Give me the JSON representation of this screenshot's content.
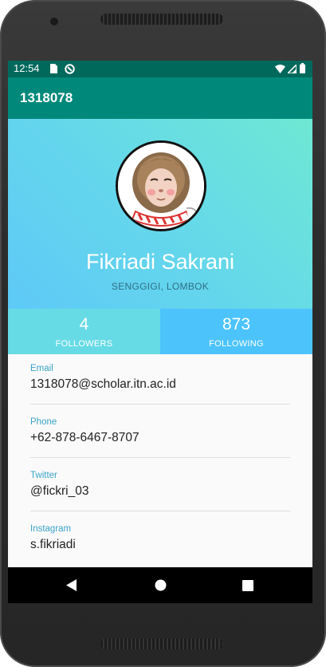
{
  "status_bar": {
    "time": "12:54",
    "icons": [
      "sim-card-icon",
      "do-not-disturb-icon",
      "wifi-icon",
      "signal-icon",
      "battery-icon"
    ]
  },
  "app_bar": {
    "title": "1318078"
  },
  "profile": {
    "name": "Fikriadi Sakrani",
    "location": "SENGGIGI, LOMBOK",
    "avatar": "monkey-avatar"
  },
  "stats": {
    "followers": {
      "count": "4",
      "label": "FOLLOWERS"
    },
    "following": {
      "count": "873",
      "label": "FOLLOWING"
    }
  },
  "details": [
    {
      "label": "Email",
      "value": "1318078@scholar.itn.ac.id"
    },
    {
      "label": "Phone",
      "value": "+62-878-6467-8707"
    },
    {
      "label": "Twitter",
      "value": "@fickri_03"
    },
    {
      "label": "Instagram",
      "value": "s.fikriadi"
    }
  ],
  "nav_bar": {
    "buttons": [
      "back-icon",
      "home-icon",
      "recents-icon"
    ]
  },
  "colors": {
    "status_bar": "#00695c",
    "app_bar": "#00897b",
    "followers_bg": "#67dbe5",
    "following_bg": "#4cc3fb",
    "label_accent": "#3aa3c6"
  }
}
